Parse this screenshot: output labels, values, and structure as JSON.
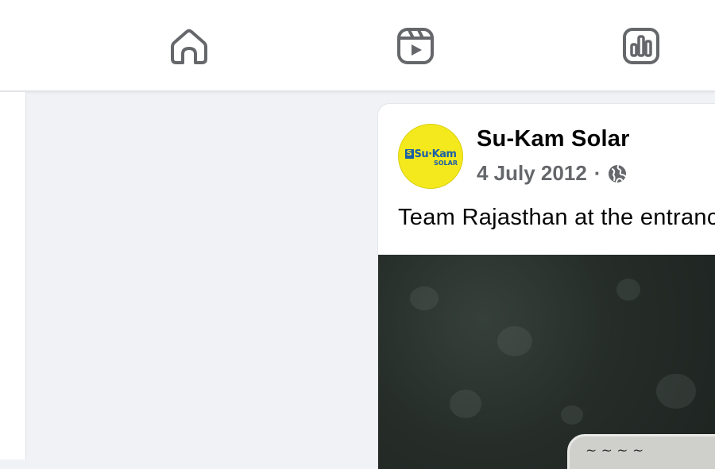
{
  "nav": {
    "items": [
      {
        "id": "home",
        "icon": "home-icon"
      },
      {
        "id": "reels",
        "icon": "reels-icon"
      },
      {
        "id": "insights",
        "icon": "insights-icon"
      }
    ]
  },
  "post": {
    "page_name": "Su-Kam Solar",
    "date": "4 July 2012",
    "separator": "·",
    "audience_icon": "globe-icon",
    "text": "Team Rajasthan at the entrance",
    "avatar_logo": {
      "brand": "Su·Kam",
      "sub": "SOLAR"
    }
  },
  "colors": {
    "background": "#f0f2f5",
    "card": "#ffffff",
    "primary_text": "#050505",
    "secondary_text": "#65676b",
    "icon": "#65676b",
    "logo_yellow": "#f4e91d",
    "logo_blue": "#1b5fa7"
  }
}
